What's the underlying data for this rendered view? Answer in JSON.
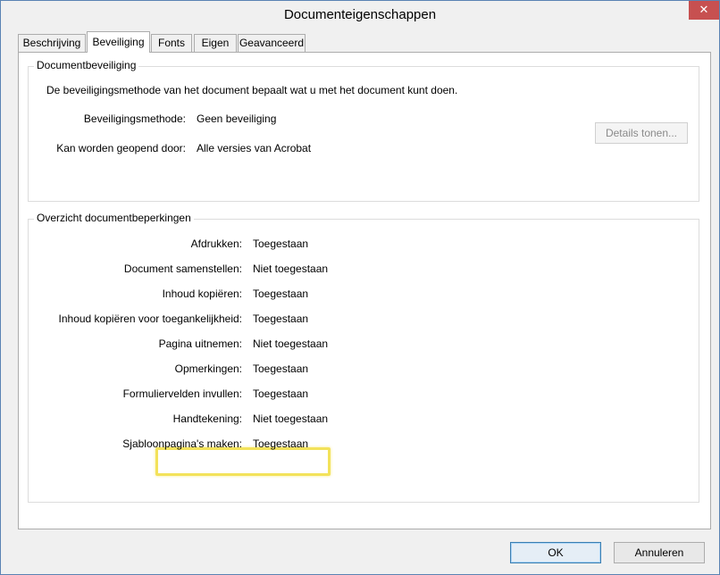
{
  "window": {
    "title": "Documenteigenschappen",
    "close_glyph": "✕"
  },
  "tabs": [
    {
      "label": "Beschrijving"
    },
    {
      "label": "Beveiliging"
    },
    {
      "label": "Fonts"
    },
    {
      "label": "Eigen"
    },
    {
      "label": "Geavanceerd"
    }
  ],
  "security": {
    "legend": "Documentbeveiliging",
    "description": "De beveiligingsmethode van het document bepaalt wat u met het document kunt doen.",
    "method_label": "Beveiligingsmethode:",
    "method_value": "Geen beveiliging",
    "details_button": "Details tonen...",
    "open_label": "Kan worden geopend door:",
    "open_value": "Alle versies van Acrobat"
  },
  "restrictions": {
    "legend": "Overzicht documentbeperkingen",
    "rows": [
      {
        "label": "Afdrukken:",
        "value": "Toegestaan"
      },
      {
        "label": "Document samenstellen:",
        "value": "Niet toegestaan"
      },
      {
        "label": "Inhoud kopiëren:",
        "value": "Toegestaan"
      },
      {
        "label": "Inhoud kopiëren voor toegankelijkheid:",
        "value": "Toegestaan"
      },
      {
        "label": "Pagina uitnemen:",
        "value": "Niet toegestaan"
      },
      {
        "label": "Opmerkingen:",
        "value": "Toegestaan"
      },
      {
        "label": "Formuliervelden invullen:",
        "value": "Toegestaan"
      },
      {
        "label": "Handtekening:",
        "value": "Niet toegestaan"
      },
      {
        "label": "Sjabloonpagina's maken:",
        "value": "Toegestaan"
      }
    ]
  },
  "footer": {
    "ok_label": "OK",
    "cancel_label": "Annuleren"
  },
  "colors": {
    "highlight": "#f3e25a",
    "close_button": "#c75050"
  }
}
